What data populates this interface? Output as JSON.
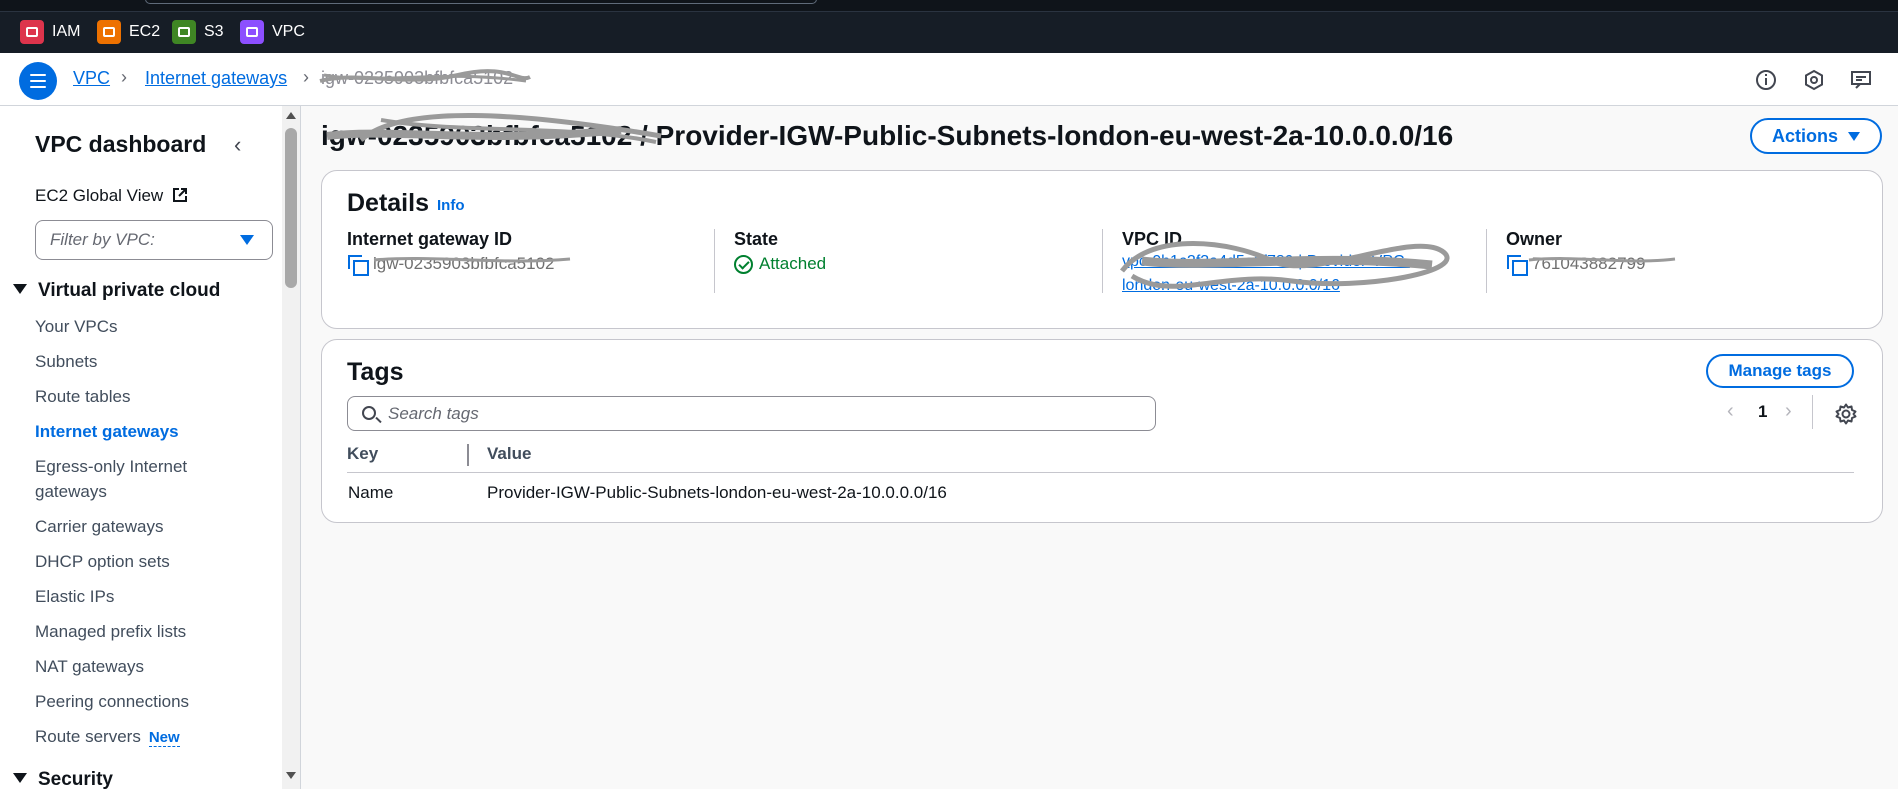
{
  "services": [
    {
      "label": "IAM",
      "color": "#dd344c"
    },
    {
      "label": "EC2",
      "color": "#ed7100"
    },
    {
      "label": "S3",
      "color": "#3f8624"
    },
    {
      "label": "VPC",
      "color": "#8c4fff"
    }
  ],
  "breadcrumb": {
    "item1": "VPC",
    "item2": "Internet gateways",
    "current": "igw-0235903bfbfca5102"
  },
  "nav": {
    "title": "VPC dashboard",
    "global_view": "EC2 Global View",
    "filter_placeholder": "Filter by VPC:",
    "section_vpc": "Virtual private cloud",
    "items": [
      "Your VPCs",
      "Subnets",
      "Route tables",
      "Internet gateways",
      "Egress-only Internet",
      "gateways",
      "Carrier gateways",
      "DHCP option sets",
      "Elastic IPs",
      "Managed prefix lists",
      "NAT gateways",
      "Peering connections",
      "Route servers"
    ],
    "new_badge": "New",
    "section_security": "Security"
  },
  "page": {
    "title_id": "igw-0235903bfbfca5102",
    "title_sep": "/",
    "title_name": "Provider-IGW-Public-Subnets-london-eu-west-2a-10.0.0.0/16",
    "actions_label": "Actions"
  },
  "details": {
    "heading": "Details",
    "info": "Info",
    "gateway_id_label": "Internet gateway ID",
    "gateway_id_value": "igw-0235903bfbfca5102",
    "state_label": "State",
    "state_value": "Attached",
    "vpc_id_label": "VPC ID",
    "vpc_id_line1": "vpc-0b1c2f3a4d5e6f789 | Provider-VPC-",
    "vpc_id_line2": "london-eu-west-2a-10.0.0.0/16",
    "owner_label": "Owner",
    "owner_value": "761043882799"
  },
  "tags": {
    "heading": "Tags",
    "manage_label": "Manage tags",
    "search_placeholder": "Search tags",
    "page_number": "1",
    "columns": [
      "Key",
      "Value"
    ],
    "rows": [
      {
        "key": "Name",
        "value": "Provider-IGW-Public-Subnets-london-eu-west-2a-10.0.0.0/16"
      }
    ]
  }
}
